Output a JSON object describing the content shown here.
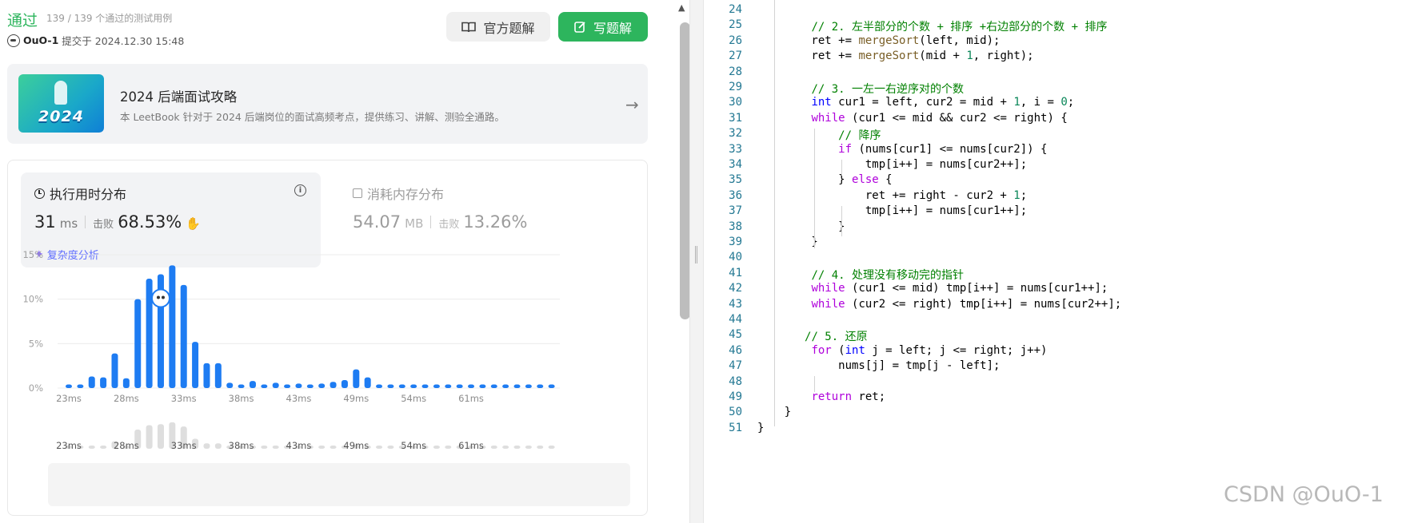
{
  "status": {
    "result": "通过",
    "testcases": "139 / 139 个通过的测试用例",
    "user": "OuO-1",
    "submitted": "提交于 2024.12.30 15:48"
  },
  "buttons": {
    "official": "官方题解",
    "write": "写题解"
  },
  "book": {
    "title": "2024 后端面试攻略",
    "desc": "本 LeetBook 针对于 2024 后端岗位的面试高频考点，提供练习、讲解、测验全通路。",
    "thumb_year": "2024"
  },
  "runtime": {
    "title": "执行用时分布",
    "value": "31",
    "unit": "ms",
    "beat_label": "击败",
    "beat": "68.53%",
    "complexity": "复杂度分析"
  },
  "memory": {
    "title": "消耗内存分布",
    "value": "54.07",
    "unit": "MB",
    "beat_label": "击败",
    "beat": "13.26%"
  },
  "chart_data": {
    "type": "bar",
    "y_ticks": [
      "15%",
      "10%",
      "5%",
      "0%"
    ],
    "ylim": [
      0,
      15
    ],
    "x_tick_labels": [
      "23ms",
      "28ms",
      "33ms",
      "38ms",
      "43ms",
      "49ms",
      "54ms",
      "61ms"
    ],
    "values": [
      0.4,
      0.4,
      1.3,
      1.2,
      3.9,
      1.1,
      10.0,
      12.3,
      12.8,
      13.8,
      11.6,
      5.2,
      2.8,
      2.8,
      0.6,
      0.4,
      0.8,
      0.4,
      0.6,
      0.4,
      0.5,
      0.4,
      0.5,
      0.7,
      0.9,
      2.1,
      1.2,
      0.4,
      0.4,
      0.4,
      0.4,
      0.4,
      0.4,
      0.4,
      0.4,
      0.4,
      0.4,
      0.4,
      0.4,
      0.4,
      0.4,
      0.4,
      0.4
    ],
    "highlight_index": 8,
    "bar_color": "#1e7cf2",
    "mini_color": "#dedede"
  },
  "code": {
    "lines": [
      {
        "n": "24",
        "html": ""
      },
      {
        "n": "25",
        "html": "        <span class='c-cm'>// 2. 左半部分的个数 + 排序 +右边部分的个数 + 排序</span>"
      },
      {
        "n": "26",
        "html": "        ret += <span class='c-fn'>mergeSort</span>(left, mid);"
      },
      {
        "n": "27",
        "html": "        ret += <span class='c-fn'>mergeSort</span>(mid + <span class='c-num'>1</span>, right);"
      },
      {
        "n": "28",
        "html": ""
      },
      {
        "n": "29",
        "html": "        <span class='c-cm'>// 3. 一左一右逆序对的个数</span>"
      },
      {
        "n": "30",
        "html": "        <span class='c-kw'>int</span> cur1 = left, cur2 = mid + <span class='c-num'>1</span>, i = <span class='c-num'>0</span>;"
      },
      {
        "n": "31",
        "html": "        <span class='c-ctl'>while</span> (cur1 &lt;= mid &amp;&amp; cur2 &lt;= right) {"
      },
      {
        "n": "32",
        "html": "            <span class='c-cm'>// 降序</span>"
      },
      {
        "n": "33",
        "html": "            <span class='c-ctl'>if</span> (nums[cur1] &lt;= nums[cur2]) {"
      },
      {
        "n": "34",
        "html": "                tmp[i++] = nums[cur2++];"
      },
      {
        "n": "35",
        "html": "            } <span class='c-ctl'>else</span> {"
      },
      {
        "n": "36",
        "html": "                ret += right - cur2 + <span class='c-num'>1</span>;"
      },
      {
        "n": "37",
        "html": "                tmp[i++] = nums[cur1++];"
      },
      {
        "n": "38",
        "html": "            }"
      },
      {
        "n": "39",
        "html": "        }"
      },
      {
        "n": "40",
        "html": ""
      },
      {
        "n": "41",
        "html": "        <span class='c-cm'>// 4. 处理没有移动完的指针</span>"
      },
      {
        "n": "42",
        "html": "        <span class='c-ctl'>while</span> (cur1 &lt;= mid) tmp[i++] = nums[cur1++];"
      },
      {
        "n": "43",
        "html": "        <span class='c-ctl'>while</span> (cur2 &lt;= right) tmp[i++] = nums[cur2++];"
      },
      {
        "n": "44",
        "html": ""
      },
      {
        "n": "45",
        "html": "       <span class='c-cm'>// 5. 还原</span>"
      },
      {
        "n": "46",
        "html": "        <span class='c-ctl'>for</span> (<span class='c-kw'>int</span> j = left; j &lt;= right; j++)"
      },
      {
        "n": "47",
        "html": "            nums[j] = tmp[j - left];"
      },
      {
        "n": "48",
        "html": ""
      },
      {
        "n": "49",
        "html": "        <span class='c-ctl'>return</span> ret;"
      },
      {
        "n": "50",
        "html": "    }"
      },
      {
        "n": "51",
        "html": "}"
      }
    ]
  },
  "watermark": "CSDN @OuO-1"
}
